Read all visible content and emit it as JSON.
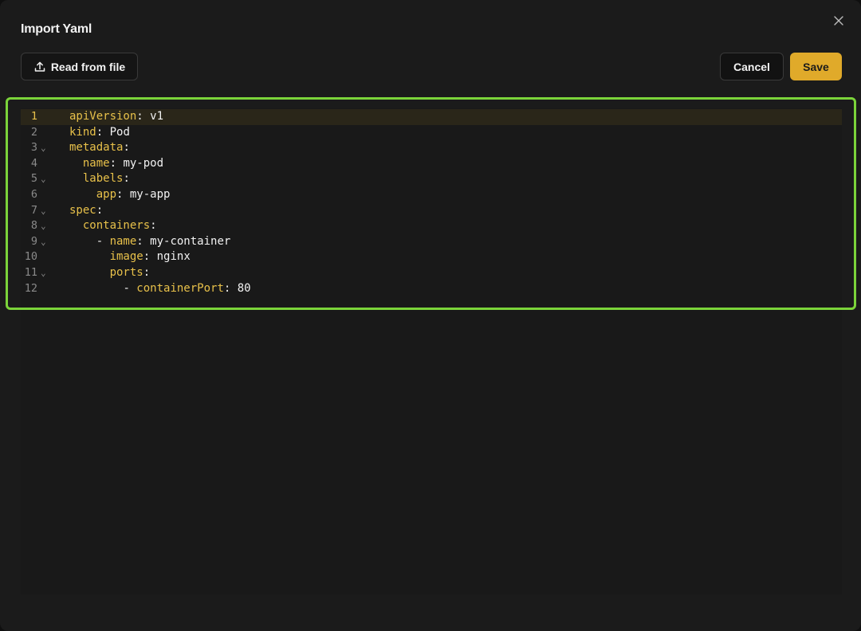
{
  "dialog": {
    "title": "Import Yaml",
    "read_file_label": "Read from file",
    "cancel_label": "Cancel",
    "save_label": "Save"
  },
  "colors": {
    "accent": "#e0aa2a",
    "highlight_border": "#7bd43a",
    "yaml_key": "#e8c14a"
  },
  "icons": {
    "close": "close-icon",
    "upload": "upload-icon",
    "fold": "chevron-down-icon"
  },
  "editor": {
    "active_line": 1,
    "lines": [
      {
        "num": "1",
        "fold": false,
        "indent": "",
        "dash": "",
        "key": "apiVersion",
        "value": " v1"
      },
      {
        "num": "2",
        "fold": false,
        "indent": "",
        "dash": "",
        "key": "kind",
        "value": " Pod"
      },
      {
        "num": "3",
        "fold": true,
        "indent": "",
        "dash": "",
        "key": "metadata",
        "value": ""
      },
      {
        "num": "4",
        "fold": false,
        "indent": "  ",
        "dash": "",
        "key": "name",
        "value": " my-pod"
      },
      {
        "num": "5",
        "fold": true,
        "indent": "  ",
        "dash": "",
        "key": "labels",
        "value": ""
      },
      {
        "num": "6",
        "fold": false,
        "indent": "    ",
        "dash": "",
        "key": "app",
        "value": " my-app"
      },
      {
        "num": "7",
        "fold": true,
        "indent": "",
        "dash": "",
        "key": "spec",
        "value": ""
      },
      {
        "num": "8",
        "fold": true,
        "indent": "  ",
        "dash": "",
        "key": "containers",
        "value": ""
      },
      {
        "num": "9",
        "fold": true,
        "indent": "    ",
        "dash": "- ",
        "key": "name",
        "value": " my-container"
      },
      {
        "num": "10",
        "fold": false,
        "indent": "      ",
        "dash": "",
        "key": "image",
        "value": " nginx"
      },
      {
        "num": "11",
        "fold": true,
        "indent": "      ",
        "dash": "",
        "key": "ports",
        "value": ""
      },
      {
        "num": "12",
        "fold": false,
        "indent": "        ",
        "dash": "- ",
        "key": "containerPort",
        "value": " 80"
      }
    ]
  }
}
